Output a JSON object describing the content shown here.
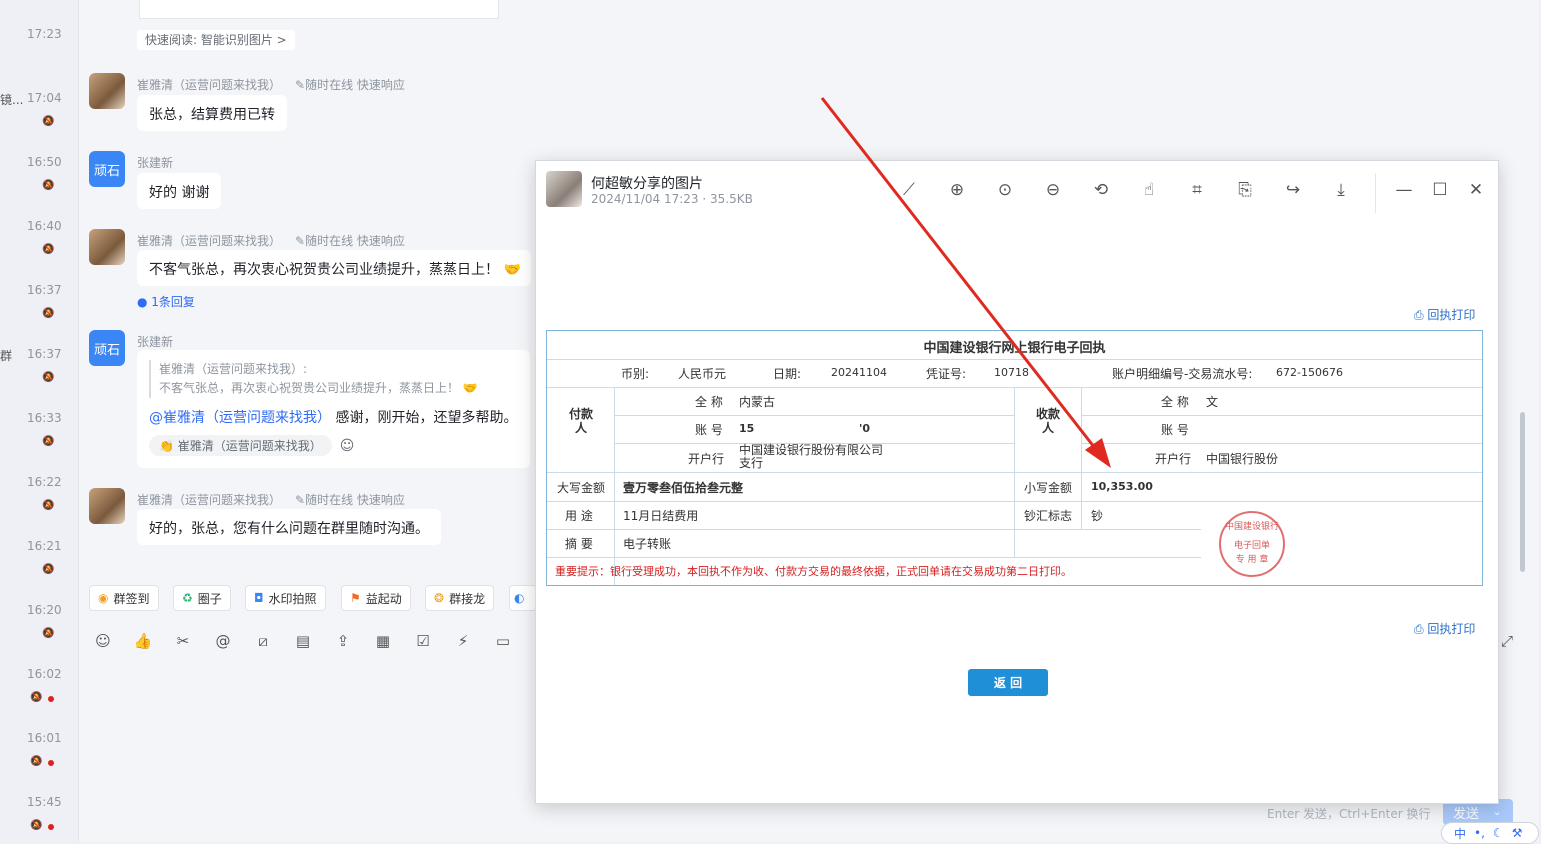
{
  "times": [
    "17:23",
    "17:04",
    "16:50",
    "16:40",
    "16:37",
    "16:37",
    "16:33",
    "16:22",
    "16:21",
    "16:20",
    "16:02",
    "16:01",
    "15:45"
  ],
  "left_snippets": [
    "镜...",
    "群"
  ],
  "quick_read": "快速阅读: 智能识别图片 >",
  "messages": [
    {
      "sender": "崔雅清（运营问题来找我）",
      "tag": "随时在线 快速响应",
      "text": "张总，结算费用已转"
    },
    {
      "sender": "张建新",
      "avatar": "顽石",
      "text": "好的 谢谢"
    },
    {
      "sender": "崔雅清（运营问题来找我）",
      "tag": "随时在线 快速响应",
      "text": "不客气张总，再次衷心祝贺贵公司业绩提升，蒸蒸日上！",
      "reply_count": "1条回复"
    },
    {
      "sender": "张建新",
      "avatar": "顽石",
      "quote_line1": "崔雅清（运营问题来找我）:",
      "quote_line2": "不客气张总，再次衷心祝贺贵公司业绩提升，蒸蒸日上！",
      "mention": "@崔雅清（运营问题来找我）",
      "text": " 感谢，刚开始，还望多帮助。",
      "reaction": "崔雅清（运营问题来找我）"
    },
    {
      "sender": "崔雅清（运营问题来找我）",
      "tag": "随时在线 快速响应",
      "text": "好的，张总，您有什么问题在群里随时沟通。"
    }
  ],
  "toolbar_chips": [
    "群签到",
    "圈子",
    "水印拍照",
    "益起动",
    "群接龙"
  ],
  "composer_hint": "Enter 发送，Ctrl+Enter 换行",
  "send_label": "发送",
  "ime": "中",
  "viewer": {
    "title": "何超敏分享的图片",
    "meta": "2024/11/04 17:23 · 35.5KB"
  },
  "receipt": {
    "print_link": "回执打印",
    "title": "中国建设银行网上银行电子回执",
    "currency_label": "币别:",
    "currency": "人民币元",
    "date_label": "日期:",
    "date": "20241104",
    "voucher_label": "凭证号:",
    "voucher": "10718",
    "serial_label": "账户明细编号-交易流水号:",
    "serial": "672-150676",
    "payer_label": "付款人",
    "payee_label": "收款人",
    "name_label": "全 称",
    "account_label": "账 号",
    "bank_label": "开户行",
    "payer_name": "内蒙古",
    "payer_account": "15",
    "payer_account_tail": "'0",
    "payer_bank_line1": "中国建设银行股份有限公司",
    "payer_bank_line2": "支行",
    "payee_name": "文",
    "payee_bank": "中国银行股份",
    "amount_words_label": "大写金额",
    "amount_words": "壹万零叁佰伍拾叁元整",
    "amount_label": "小写金额",
    "amount": "10,353.00",
    "purpose_label": "用 途",
    "purpose": "11月日结费用",
    "cash_label": "钞汇标志",
    "cash": "钞",
    "summary_label": "摘 要",
    "summary": "电子转账",
    "notice": "重要提示：银行受理成功，本回执不作为收、付款方交易的最终依据，正式回单请在交易成功第二日打印。",
    "stamp_top": "中国建设银行",
    "stamp_mid": "电子回单",
    "stamp_bot": "专 用 章",
    "return_button": "返 回"
  }
}
